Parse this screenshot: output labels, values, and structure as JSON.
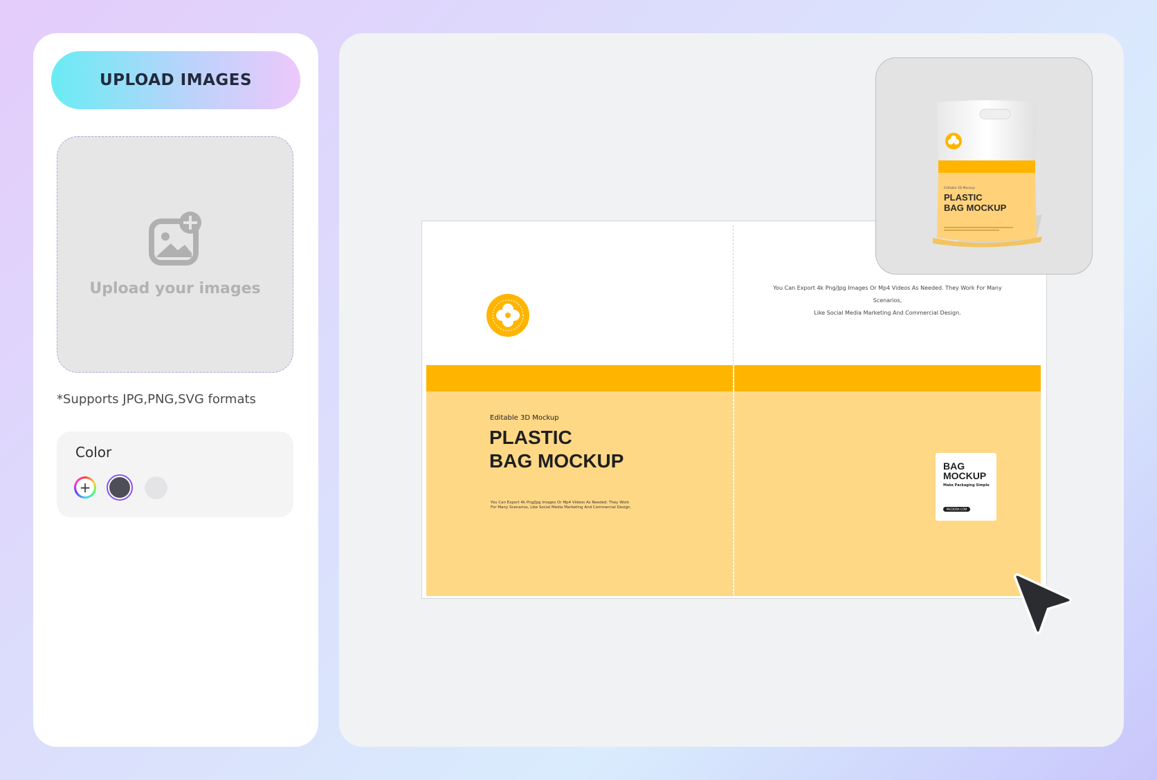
{
  "sidebar": {
    "upload_button_label": "UPLOAD IMAGES",
    "dropzone": {
      "text": "Upload your images",
      "icon": "image-add-icon"
    },
    "formats_note": "*Supports JPG,PNG,SVG formats",
    "color": {
      "title": "Color",
      "swatches": [
        {
          "name": "add-color",
          "icon": "plus-icon",
          "symbol": "+"
        },
        {
          "name": "dark-gray",
          "hex": "#4e4e58",
          "selected": true
        },
        {
          "name": "light-gray",
          "hex": "#e4e4e6",
          "selected": false
        }
      ]
    }
  },
  "canvas": {
    "bag_dieline": {
      "front": {
        "eyebrow": "Editable 3D Mockup",
        "title_line1": "PLASTIC",
        "title_line2": "BAG MOCKUP",
        "body_copy": "You Can Export 4k Png/Jpg Images Or Mp4 Videos As Needed. They Work For Many Scenarios, Like Social Media Marketing And Commercial Design."
      },
      "back": {
        "copy_line1": "You Can Export 4k Png/Jpg Images Or Mp4 Videos As Needed. They Work For Many Scenarios,",
        "copy_line2": "Like Social Media Marketing And Commercial Design.",
        "label": {
          "title_line1": "BAG",
          "title_line2": "MOCKUP",
          "subtitle": "Make Packaging Simple",
          "pill": "PACDORA.COM"
        }
      }
    },
    "preview_3d": {
      "eyebrow": "Editable 3D Mockup",
      "title_line1": "PLASTIC",
      "title_line2": "BAG MOCKUP"
    }
  },
  "colors": {
    "accent_orange": "#ffb500",
    "bag_yellow": "#ffd886",
    "selection_purple": "#8a4ff0"
  }
}
